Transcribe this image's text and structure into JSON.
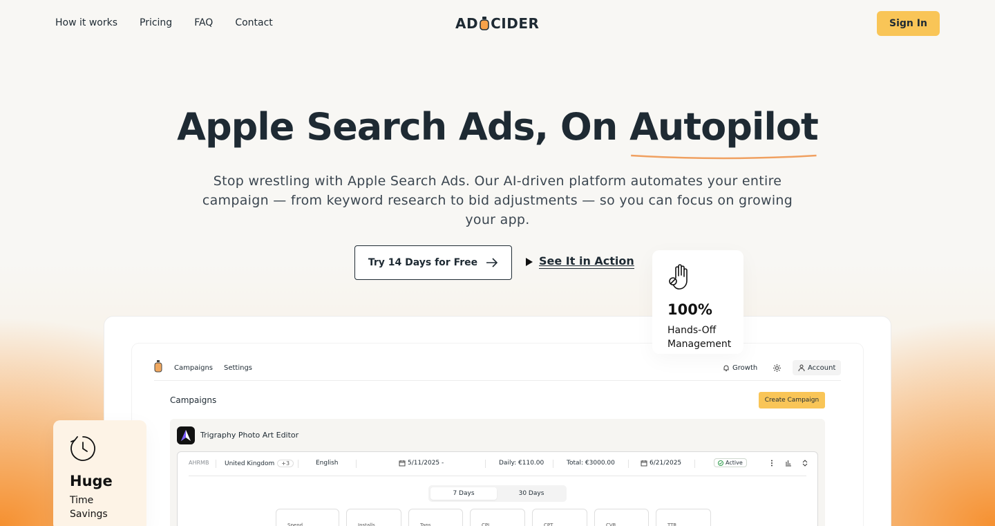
{
  "nav": {
    "links": [
      "How it works",
      "Pricing",
      "FAQ",
      "Contact"
    ],
    "logo_left": "AD",
    "logo_right": "CIDER",
    "signin": "Sign In"
  },
  "hero": {
    "title_main": "Apple Search Ads, On ",
    "title_highlight": "Autopilot",
    "subtitle": "Stop wrestling with Apple Search Ads. Our AI-driven platform automates your entire campaign — from keyword research to bid adjustments — so you can focus on growing your app.",
    "cta_primary": "Try 14 Days for Free",
    "cta_secondary": "See It in Action"
  },
  "cards": {
    "handsoff": {
      "big": "100%",
      "line1": "Hands-Off",
      "line2": "Management",
      "icon": "hand-icon"
    },
    "time": {
      "big": "Huge",
      "line1": "Time",
      "line2": "Savings",
      "icon": "clock-icon"
    }
  },
  "app": {
    "tabs": [
      "Campaigns",
      "Settings"
    ],
    "plan": "Growth",
    "account": "Account",
    "page_title": "Campaigns",
    "create_button": "Create Campaign",
    "app_name": "Trigraphy Photo Art Editor",
    "campaign": {
      "code": "AHRMB",
      "country": "United Kingdom",
      "country_extra": "+3",
      "language": "English",
      "start": "5/11/2025 -",
      "daily": "Daily: €110.00",
      "total": "Total: €3000.00",
      "end": "6/21/2025",
      "status": "Active"
    },
    "ranges": [
      "7 Days",
      "30 Days"
    ],
    "metrics": [
      "Spend",
      "Installs",
      "Taps",
      "CPI",
      "CPT",
      "CVR",
      "TTR"
    ]
  },
  "colors": {
    "accent": "#f9c557",
    "text": "#1e2a33",
    "underline": "#f0a060"
  }
}
